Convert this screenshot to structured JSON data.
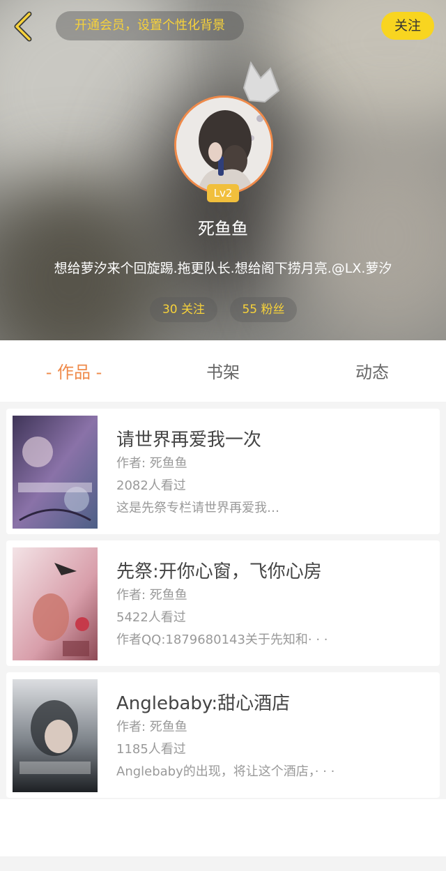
{
  "header": {
    "vip_prompt": "开通会员，设置个性化背景",
    "follow_label": "关注",
    "level": "Lv2",
    "username": "死鱼鱼",
    "bio": "想给萝汐来个回旋踢.拖更队长.想给阁下捞月亮.@LX.萝汐",
    "following": "30 关注",
    "followers": "55 粉丝"
  },
  "tabs": [
    {
      "label": "- 作品 -",
      "active": true
    },
    {
      "label": "书架",
      "active": false
    },
    {
      "label": "动态",
      "active": false
    }
  ],
  "works": [
    {
      "title": "请世界再爱我一次",
      "author": "作者: 死鱼鱼",
      "views": "2082人看过",
      "summary": "这是先祭专栏请世界再爱我…",
      "cover_colors": [
        "#4a3f66",
        "#9c7fb6",
        "#6d7fa8"
      ]
    },
    {
      "title": "先祭:开你心窗，飞你心房",
      "author": "作者: 死鱼鱼",
      "views": "5422人看过",
      "summary": "作者QQ:1879680143关于先知和· · ·",
      "cover_colors": [
        "#f1dce0",
        "#d99aa7",
        "#7a3e4a"
      ]
    },
    {
      "title": "Anglebaby:甜心酒店",
      "author": "作者: 死鱼鱼",
      "views": "1185人看过",
      "summary": "Anglebaby的出现，将让这个酒店，· · ·",
      "cover_colors": [
        "#d6d8db",
        "#5a5f66",
        "#1f2226"
      ]
    }
  ],
  "colors": {
    "accent_orange": "#ef8a4a",
    "accent_yellow": "#f8d520",
    "text_dark": "#444444",
    "text_muted": "#999999"
  }
}
